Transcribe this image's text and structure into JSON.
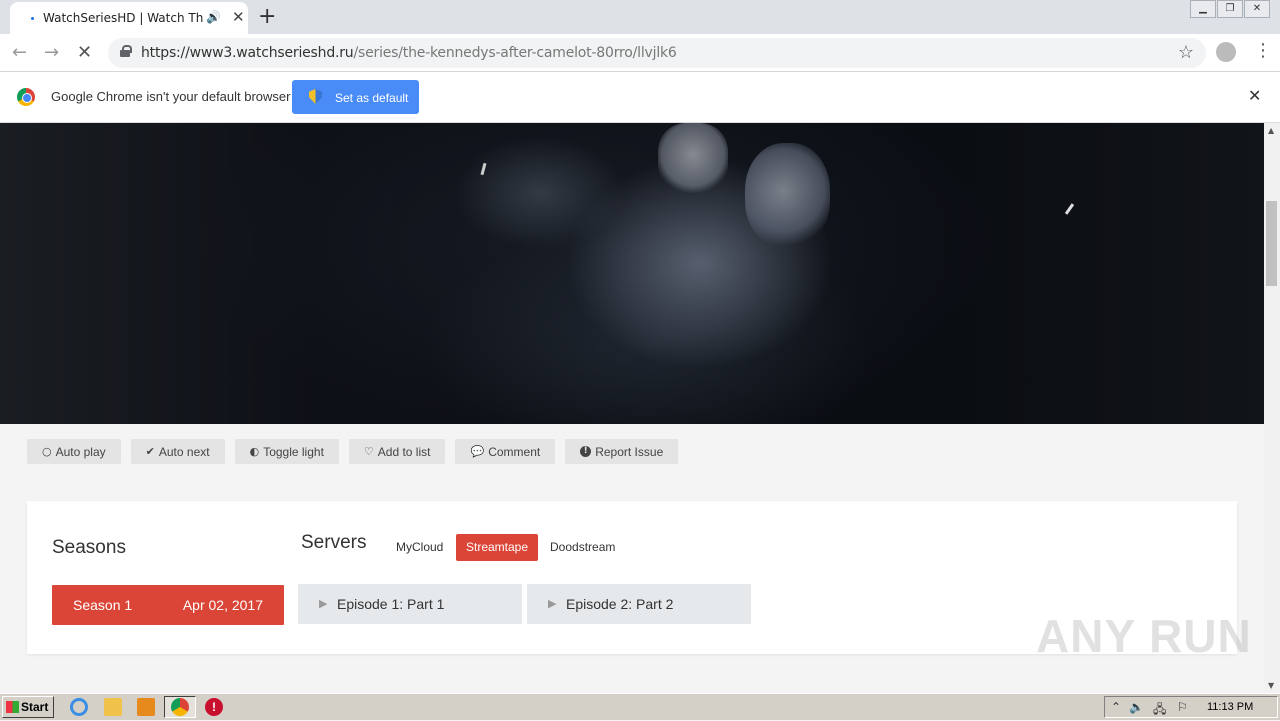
{
  "browser": {
    "tab_title": "WatchSeriesHD | Watch The Kennedys After Camelot",
    "url_host": "https://www3.watchserieshd.ru",
    "url_path": "/series/the-kennedys-after-camelot-80rro/llvjlk6",
    "infobar_text": "Google Chrome isn't your default browser",
    "set_default_label": "Set as default"
  },
  "player": {
    "controls": [
      {
        "icon": "circle-icon",
        "glyph": "○",
        "label": "Auto play"
      },
      {
        "icon": "check-circle-icon",
        "glyph": "✔",
        "label": "Auto next"
      },
      {
        "icon": "half-circle-icon",
        "glyph": "◐",
        "label": "Toggle light"
      },
      {
        "icon": "heart-icon",
        "glyph": "♡",
        "label": "Add to list"
      },
      {
        "icon": "comment-icon",
        "glyph": "💬",
        "label": "Comment"
      },
      {
        "icon": "alert-icon",
        "glyph": "!",
        "label": "Report Issue"
      }
    ]
  },
  "episodes_panel": {
    "seasons_heading": "Seasons",
    "servers_heading": "Servers",
    "servers": [
      {
        "label": "MyCloud",
        "active": false
      },
      {
        "label": "Streamtape",
        "active": true
      },
      {
        "label": "Doodstream",
        "active": false
      }
    ],
    "season": {
      "name": "Season 1",
      "date": "Apr 02, 2017"
    },
    "episodes": [
      {
        "label": "Episode 1: Part 1"
      },
      {
        "label": "Episode 2: Part 2"
      }
    ]
  },
  "watermark": "ANY RUN",
  "taskbar": {
    "start_label": "Start",
    "clock": "11:13 PM"
  },
  "colors": {
    "accent": "#db4537",
    "chrome_blue": "#4a8cf7"
  }
}
